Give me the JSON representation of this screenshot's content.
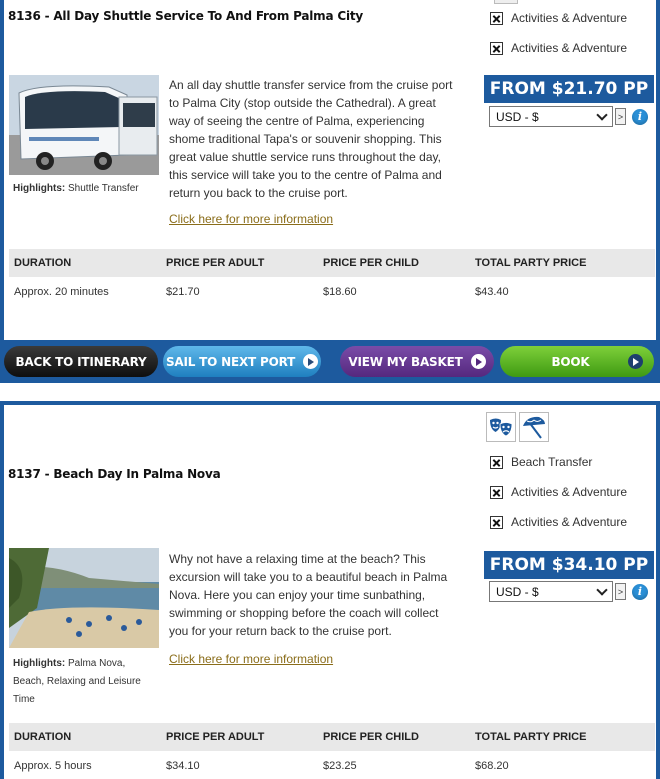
{
  "excursions": [
    {
      "title": "8136 - All Day Shuttle Service To And From Palma City",
      "categories": [
        "Activities & Adventure",
        "Activities & Adventure"
      ],
      "highlights_label": "Highlights:",
      "highlights": "Shuttle Transfer",
      "description": "An all day shuttle transfer service from the cruise port to Palma City (stop outside the Cathedral).  A great way of seeing the centre of Palma, experiencing shome traditional Tapa's or souvenir shopping.  This great value shuttle service runs throughout the day, this service will take you to the centre of Palma and return you back to the cruise port.",
      "more_link": "Click here for more information",
      "price": "FROM $21.70 PP",
      "currency": "USD - $",
      "go": ">",
      "table": {
        "headers": [
          "DURATION",
          "PRICE PER ADULT",
          "PRICE PER CHILD",
          "TOTAL PARTY PRICE"
        ],
        "row": [
          "Approx. 20 minutes",
          "$21.70",
          "$18.60",
          "$43.40"
        ]
      }
    },
    {
      "title": "8137 - Beach Day In Palma Nova",
      "categories": [
        "Beach Transfer",
        "Activities & Adventure",
        "Activities & Adventure"
      ],
      "highlights_label": "Highlights:",
      "highlights": "Palma Nova, Beach, Relaxing and Leisure Time",
      "description": "Why not have a relaxing time at the beach?  This excursion will take you to a beautiful beach in Palma Nova.  Here you can enjoy your time sunbathing, swimming or shopping before the coach will collect you for your return back to the cruise port.",
      "more_link": "Click here for more information",
      "price": "FROM $34.10 PP",
      "currency": "USD - $",
      "go": ">",
      "table": {
        "headers": [
          "DURATION",
          "PRICE PER ADULT",
          "PRICE PER CHILD",
          "TOTAL PARTY PRICE"
        ],
        "row": [
          "Approx. 5 hours",
          "$34.10",
          "$23.25",
          "$68.20"
        ]
      }
    }
  ],
  "actions": {
    "back": "BACK TO ITINERARY",
    "sail": "SAIL TO NEXT PORT",
    "basket": "VIEW MY BASKET",
    "book": "BOOK"
  },
  "icons": {
    "theme": [
      "theatre-masks-icon",
      "beach-umbrella-icon"
    ],
    "info": "info-icon",
    "category": "checkbox-x-icon"
  },
  "colors": {
    "brand_blue": "#1d5a9e",
    "link": "#8a6d1a",
    "book_green": "#5bb527",
    "basket_purple": "#6a3a96",
    "sail_blue": "#3a9ad6"
  }
}
